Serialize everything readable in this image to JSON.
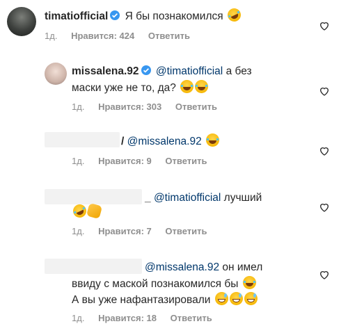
{
  "comments": [
    {
      "username": "timatiofficial",
      "text": "Я бы познакомился",
      "emojis": [
        "rofl"
      ],
      "time": "1д.",
      "likes": "Нравится: 424",
      "reply": "Ответить"
    },
    {
      "username": "missalena.92",
      "mention": "@timatiofficial",
      "text_line1": "а без",
      "text_line2": "маски уже не то, да?",
      "emojis": [
        "laugh",
        "laugh"
      ],
      "time": "1д.",
      "likes": "Нравится: 303",
      "reply": "Ответить"
    },
    {
      "username_fragment": "/",
      "mention": "@missalena.92",
      "emojis": [
        "laugh"
      ],
      "time": "1д.",
      "likes": "Нравится: 9",
      "reply": "Ответить"
    },
    {
      "username_fragment": "_",
      "mention": "@timatiofficial",
      "text": "лучший",
      "emojis": [
        "rofl",
        "clap"
      ],
      "time": "1д.",
      "likes": "Нравится: 7",
      "reply": "Ответить"
    },
    {
      "mention": "@missalena.92",
      "text_line1": "он имел",
      "text_line2": "ввиду с маской познакомился бы",
      "text_line3": "А вы уже  нафантазировали",
      "emojis": [
        "laugh",
        "grin",
        "grin",
        "grin"
      ],
      "time": "1д.",
      "likes": "Нравится: 18",
      "reply": "Ответить"
    }
  ],
  "colors": {
    "text": "#262626",
    "mention": "#00376b",
    "meta": "#8e8e8e",
    "verified": "#3897f0"
  },
  "icons": [
    "verified-badge-icon",
    "heart-icon"
  ]
}
